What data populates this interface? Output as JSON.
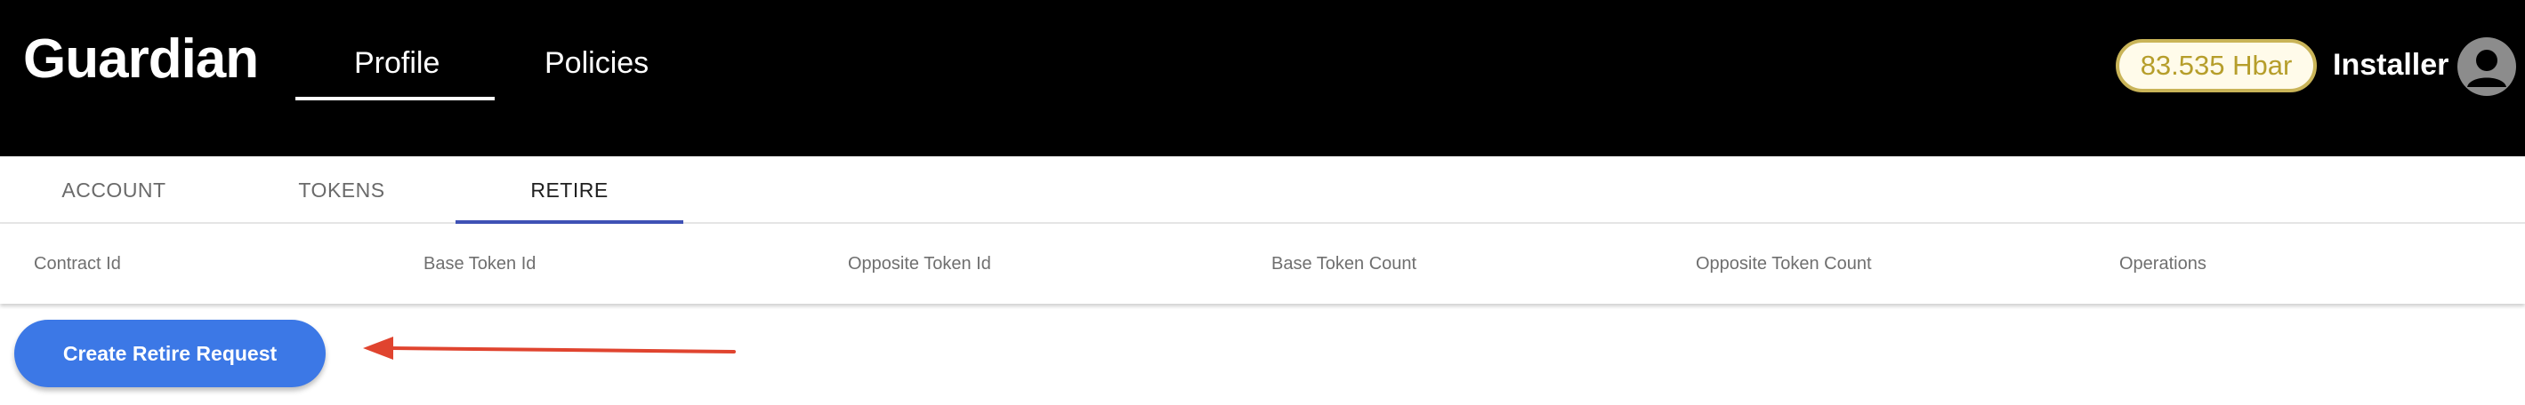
{
  "header": {
    "brand": "Guardian",
    "nav": [
      {
        "label": "Profile",
        "active": true
      },
      {
        "label": "Policies",
        "active": false
      }
    ],
    "balance": "83.535 Hbar",
    "username": "Installer",
    "avatar_icon": "user-circle-icon"
  },
  "tabs": [
    {
      "label": "ACCOUNT",
      "active": false
    },
    {
      "label": "TOKENS",
      "active": false
    },
    {
      "label": "RETIRE",
      "active": true
    }
  ],
  "table": {
    "columns": [
      "Contract Id",
      "Base Token Id",
      "Opposite Token Id",
      "Base Token Count",
      "Opposite Token Count",
      "Operations"
    ],
    "rows": []
  },
  "actions": {
    "create_retire_request": "Create Retire Request"
  },
  "annotation": {
    "arrow_color": "#e0442f",
    "arrow_icon": "left-arrow-annotation"
  },
  "colors": {
    "header_bg": "#000000",
    "primary_button": "#3c78e6",
    "active_tab_indicator": "#3f51b5",
    "balance_text": "#b69e2b"
  }
}
